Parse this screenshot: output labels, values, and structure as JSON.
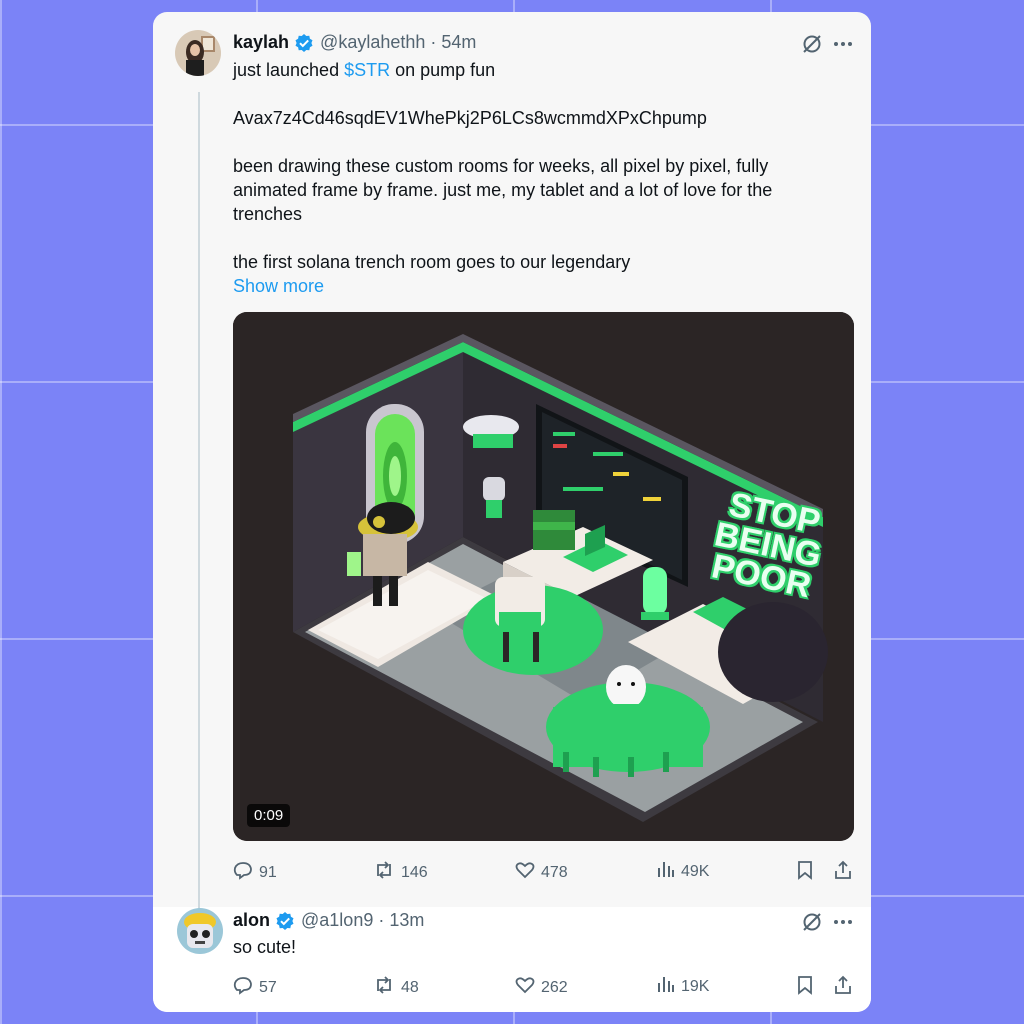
{
  "post": {
    "author_name": "kaylah",
    "author_handle": "@kaylahethh",
    "separator": "·",
    "time": "54m",
    "line1_prefix": "just launched ",
    "ticker": "$STR",
    "line1_suffix": " on pump fun",
    "contract": "Avax7z4Cd46sqdEV1WhePkj2P6LCs8wcmmdXPxChpump",
    "paragraph": "been drawing these custom rooms for weeks, all pixel by pixel, fully animated frame by frame. just me, my tablet and a lot of love for the trenches",
    "last_line": "the first solana trench room goes to our legendary",
    "show_more": "Show more",
    "video": {
      "duration": "0:09",
      "sign_lines": [
        "STOP",
        "BEING",
        "POOR"
      ]
    },
    "stats": {
      "replies": "91",
      "reposts": "146",
      "likes": "478",
      "views": "49K"
    }
  },
  "reply": {
    "author_name": "alon",
    "author_handle": "@a1lon9",
    "separator": "·",
    "time": "13m",
    "text": "so cute!",
    "stats": {
      "replies": "57",
      "reposts": "48",
      "likes": "262",
      "views": "19K"
    }
  },
  "colors": {
    "background": "#7b83f7",
    "link": "#1d9bf0",
    "verified": "#1d9bf0",
    "room_green": "#2fcf6b"
  }
}
